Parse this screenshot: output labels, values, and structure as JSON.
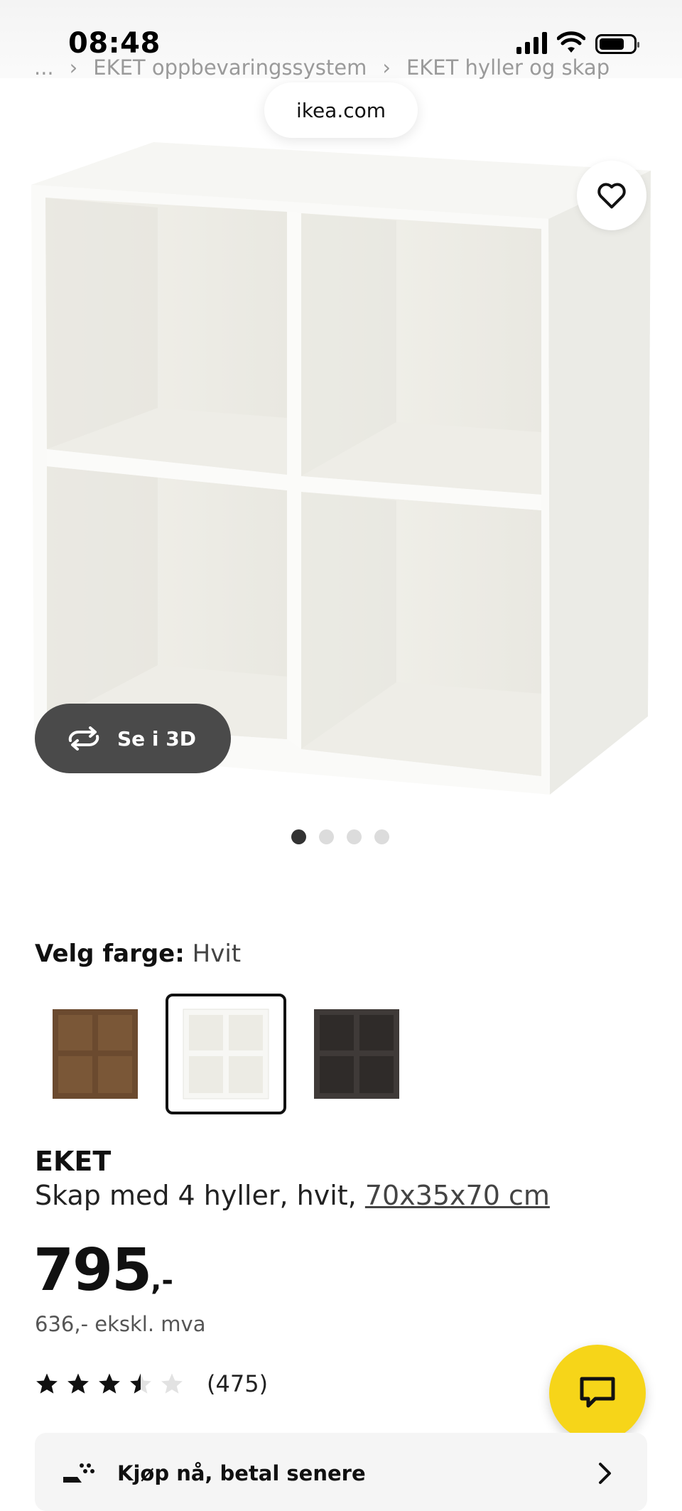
{
  "status": {
    "time": "08:48"
  },
  "breadcrumb": {
    "items": [
      "...",
      "EKET oppbevaringssystem",
      "EKET hyller og skap"
    ]
  },
  "browser": {
    "url": "ikea.com"
  },
  "gallery": {
    "view3d_label": "Se i 3D",
    "image_count": 4,
    "active_index": 0
  },
  "color_picker": {
    "label": "Velg farge:",
    "selected_value": "Hvit",
    "options": [
      "walnut",
      "white",
      "dark-grey"
    ],
    "selected_index": 1
  },
  "product": {
    "name": "EKET",
    "description": "Skap med 4 hyller, hvit,",
    "dimensions": "70x35x70 cm",
    "price": "795",
    "price_suffix": ",-",
    "price_excl_vat": "636,- ekskl. mva",
    "rating": 3.5,
    "rating_max": 5,
    "review_count": "(475)"
  },
  "payment": {
    "label": "Kjøp nå, betal senere"
  },
  "colors": {
    "accent_yellow": "#f6d519",
    "button_dark": "#4a4a4a",
    "text_muted": "#9a9a9a"
  }
}
